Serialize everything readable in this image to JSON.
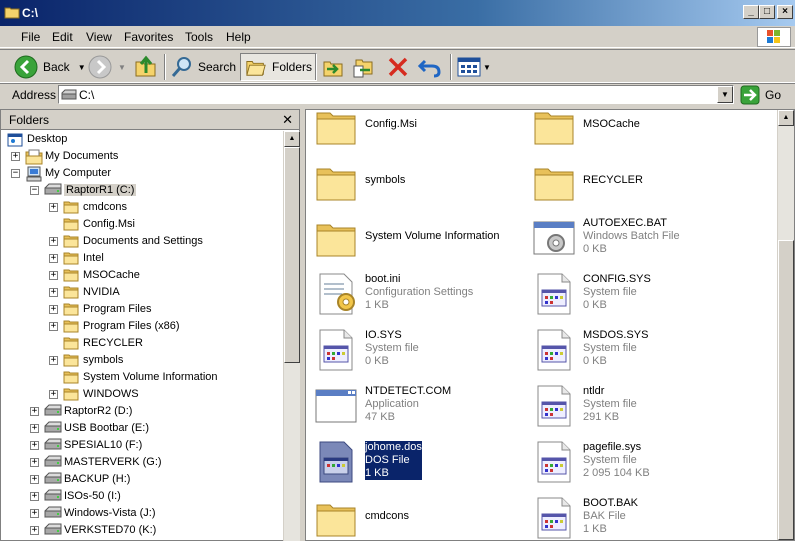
{
  "window": {
    "title": "C:\\"
  },
  "menu": [
    "File",
    "Edit",
    "View",
    "Favorites",
    "Tools",
    "Help"
  ],
  "toolbar": {
    "back": "Back",
    "search": "Search",
    "folders": "Folders"
  },
  "address": {
    "label": "Address",
    "value": "C:\\",
    "go": "Go"
  },
  "folders_pane": {
    "title": "Folders",
    "tree": [
      {
        "label": "Desktop",
        "icon": "desktop-icon",
        "toggle": ""
      },
      {
        "label": "My Documents",
        "icon": "my-documents-icon",
        "toggle": "+"
      },
      {
        "label": "My Computer",
        "icon": "my-computer-icon",
        "toggle": "-"
      },
      {
        "label": "RaptorR1 (C:)",
        "icon": "drive-icon",
        "toggle": "-"
      },
      {
        "label": "cmdcons",
        "icon": "folder-icon",
        "toggle": "+"
      },
      {
        "label": "Config.Msi",
        "icon": "folder-icon",
        "toggle": ""
      },
      {
        "label": "Documents and Settings",
        "icon": "folder-icon",
        "toggle": "+"
      },
      {
        "label": "Intel",
        "icon": "folder-icon",
        "toggle": "+"
      },
      {
        "label": "MSOCache",
        "icon": "folder-icon",
        "toggle": "+"
      },
      {
        "label": "NVIDIA",
        "icon": "folder-icon",
        "toggle": "+"
      },
      {
        "label": "Program Files",
        "icon": "folder-icon",
        "toggle": "+"
      },
      {
        "label": "Program Files (x86)",
        "icon": "folder-icon",
        "toggle": "+"
      },
      {
        "label": "RECYCLER",
        "icon": "folder-icon",
        "toggle": ""
      },
      {
        "label": "symbols",
        "icon": "folder-icon",
        "toggle": "+"
      },
      {
        "label": "System Volume Information",
        "icon": "folder-icon",
        "toggle": ""
      },
      {
        "label": "WINDOWS",
        "icon": "folder-icon",
        "toggle": "+"
      },
      {
        "label": "RaptorR2 (D:)",
        "icon": "drive-icon",
        "toggle": "+"
      },
      {
        "label": "USB Bootbar (E:)",
        "icon": "drive-icon",
        "toggle": "+"
      },
      {
        "label": "SPESIAL10 (F:)",
        "icon": "drive-icon",
        "toggle": "+"
      },
      {
        "label": "MASTERVERK (G:)",
        "icon": "drive-icon",
        "toggle": "+"
      },
      {
        "label": "BACKUP (H:)",
        "icon": "drive-icon",
        "toggle": "+"
      },
      {
        "label": "ISOs-50 (I:)",
        "icon": "drive-icon",
        "toggle": "+"
      },
      {
        "label": "Windows-Vista (J:)",
        "icon": "drive-icon",
        "toggle": "+"
      },
      {
        "label": "VERKSTED70 (K:)",
        "icon": "drive-icon",
        "toggle": "+"
      }
    ]
  },
  "files": [
    {
      "name": "Config.Msi",
      "type": "",
      "size": "",
      "icon": "folder-icon"
    },
    {
      "name": "MSOCache",
      "type": "",
      "size": "",
      "icon": "folder-icon"
    },
    {
      "name": "symbols",
      "type": "",
      "size": "",
      "icon": "folder-icon"
    },
    {
      "name": "RECYCLER",
      "type": "",
      "size": "",
      "icon": "folder-icon"
    },
    {
      "name": "System Volume Information",
      "type": "",
      "size": "",
      "icon": "folder-icon"
    },
    {
      "name": "AUTOEXEC.BAT",
      "type": "Windows Batch File",
      "size": "0 KB",
      "icon": "batch-file-icon"
    },
    {
      "name": "boot.ini",
      "type": "Configuration Settings",
      "size": "1 KB",
      "icon": "config-file-icon"
    },
    {
      "name": "CONFIG.SYS",
      "type": "System file",
      "size": "0 KB",
      "icon": "system-file-icon"
    },
    {
      "name": "IO.SYS",
      "type": "System file",
      "size": "0 KB",
      "icon": "system-file-icon"
    },
    {
      "name": "MSDOS.SYS",
      "type": "System file",
      "size": "0 KB",
      "icon": "system-file-icon"
    },
    {
      "name": "NTDETECT.COM",
      "type": "Application",
      "size": "47 KB",
      "icon": "application-icon"
    },
    {
      "name": "ntldr",
      "type": "System file",
      "size": "291 KB",
      "icon": "system-file-icon"
    },
    {
      "name": "johome.dos",
      "type": "DOS File",
      "size": "1 KB",
      "icon": "dos-file-icon"
    },
    {
      "name": "pagefile.sys",
      "type": "System file",
      "size": "2 095 104 KB",
      "icon": "system-file-icon"
    },
    {
      "name": "cmdcons",
      "type": "",
      "size": "",
      "icon": "folder-icon"
    },
    {
      "name": "BOOT.BAK",
      "type": "BAK File",
      "size": "1 KB",
      "icon": "system-file-icon"
    }
  ],
  "selected_file": "johome.dos",
  "colors": {
    "selection": "#0a246a",
    "titlebar": "#0a246a"
  }
}
